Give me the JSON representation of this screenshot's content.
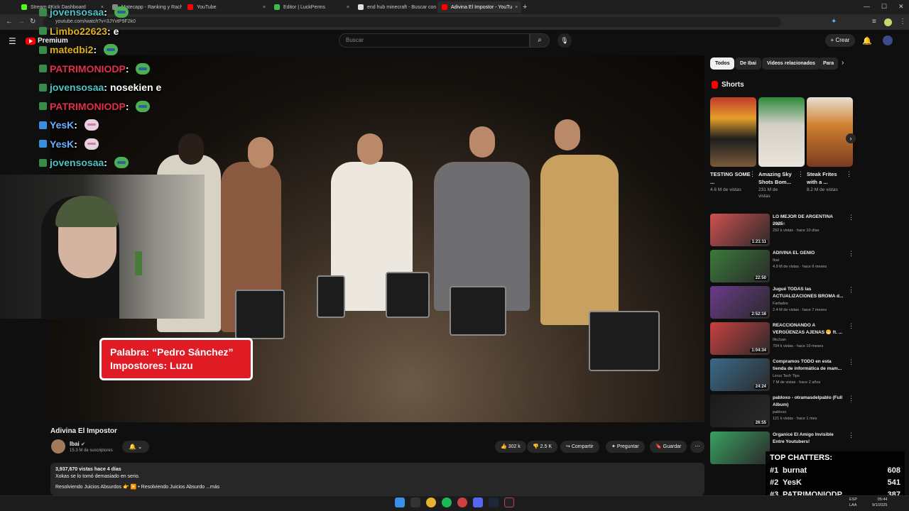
{
  "browser": {
    "tabs": [
      {
        "title": "Stream #Kick Dashboard",
        "color": "#53fc18"
      },
      {
        "title": "Matecapp - Ranking y Racha di",
        "color": "#888888"
      },
      {
        "title": "YouTube",
        "color": "#ff0000"
      },
      {
        "title": "Editor | LuckPerms",
        "color": "#3cba54"
      },
      {
        "title": "end hub minecraft - Buscar con",
        "color": "#e0e0e0"
      },
      {
        "title": "Adivina El Impostor - YouTu",
        "color": "#ff0000"
      }
    ],
    "url": "youtube.com/watch?v=3JYvtP9F2k0",
    "new_tab": "+"
  },
  "youtube": {
    "logo_label": "Premium",
    "search_placeholder": "Buscar",
    "create_label": "Crear"
  },
  "chat": [
    {
      "user": "jovensosaa",
      "color": "#4fc3c8",
      "msg": "",
      "emote": "pepe"
    },
    {
      "user": "Limbo22623",
      "color": "#e0b020",
      "msg": "e",
      "emote": ""
    },
    {
      "user": "matedbi2",
      "color": "#e0b020",
      "msg": "",
      "emote": "pepe"
    },
    {
      "user": "PATRIMONIODP",
      "color": "#e0304a",
      "msg": "",
      "emote": "pepe"
    },
    {
      "user": "jovensosaa",
      "color": "#4fc3c8",
      "msg": "nosekien e",
      "emote": ""
    },
    {
      "user": "PATRIMONIODP",
      "color": "#e0304a",
      "msg": "",
      "emote": "pepe"
    },
    {
      "user": "YesK",
      "color": "#6ab0ff",
      "msg": "",
      "emote": "cat"
    },
    {
      "user": "YesK",
      "color": "#6ab0ff",
      "msg": "",
      "emote": "cat"
    },
    {
      "user": "jovensosaa",
      "color": "#4fc3c8",
      "msg": "",
      "emote": "pepe"
    }
  ],
  "video": {
    "overlay_line1": "Palabra: “Pedro Sánchez”",
    "overlay_line2": "Impostores: Luzu",
    "title": "Adivina El Impostor",
    "channel": "Ibai",
    "subscribers": "15.3 M de suscriptores",
    "likes": "302 k",
    "dislikes": "2.5 K",
    "share": "Compartir",
    "ask": "Preguntar",
    "save": "Guardar",
    "views_line": "3,937,670 vistas  hace 4 días",
    "desc_line1": "Xokas se lo tomó demasiado en serio.",
    "desc_line2": "Resolviendo Juicios Absurdos 👉 ▶️ • Resolviendo Juicios Absurdo ...más"
  },
  "sidebar": {
    "chips": [
      "Todos",
      "De Ibai",
      "Videos relacionados",
      "Para"
    ],
    "shorts_label": "Shorts",
    "shorts": [
      {
        "title": "TESTING SOME ...",
        "views": "4.6 M de vistas"
      },
      {
        "title": "Amazing Sky Shots Bom...",
        "views": "231 M de vistas"
      },
      {
        "title": "Steak Frites with a ...",
        "views": "8.2 M de vistas"
      }
    ],
    "recommended": [
      {
        "title": "LO MEJOR DE ARGENTINA 2025",
        "channel": "PapaiX",
        "meta": "292 k vistas · hace 10 días",
        "duration": "1:21:11"
      },
      {
        "title": "ADIVINA EL GENIO",
        "channel": "Ibai",
        "meta": "4.9 M de vistas · hace 6 meses",
        "duration": "22:50"
      },
      {
        "title": "Jugué TODAS las ACTUALIZACIONES BROMA d...",
        "channel": "Farfadox",
        "meta": "2.4 M de vistas · hace 7 meses",
        "duration": "2:52:16"
      },
      {
        "title": "REACCIONANDO A VERGÜENZAS AJENAS 😬 ft. ...",
        "channel": "IlloJuan",
        "meta": "704 k vistas · hace 10 meses",
        "duration": "1:04:34"
      },
      {
        "title": "Compramos TODO en esta tienda de informática de mam...",
        "channel": "Linus Tech Tips",
        "meta": "7 M de vistas · hace 2 años",
        "duration": "24:24"
      },
      {
        "title": "pabloxo - otramasdelpablo (Full Album)",
        "channel": "pabloxo",
        "meta": "121 k vistas · hace 1 mes",
        "duration": "26:55"
      },
      {
        "title": "Organicé El Amigo Invisible Entre Youtubers!",
        "channel": "",
        "meta": "",
        "duration": ""
      }
    ]
  },
  "top_chatters": {
    "title": "TOP CHATTERS:",
    "rows": [
      {
        "rank": "#1",
        "name": "burnat",
        "count": "608"
      },
      {
        "rank": "#2",
        "name": "YesK",
        "count": "541"
      },
      {
        "rank": "#3",
        "name": "PATRIMONIODP",
        "count": "387"
      }
    ]
  },
  "taskbar": {
    "lang": "ESP",
    "lang2": "LAA",
    "time": "05:44",
    "date": "9/1/2025"
  }
}
